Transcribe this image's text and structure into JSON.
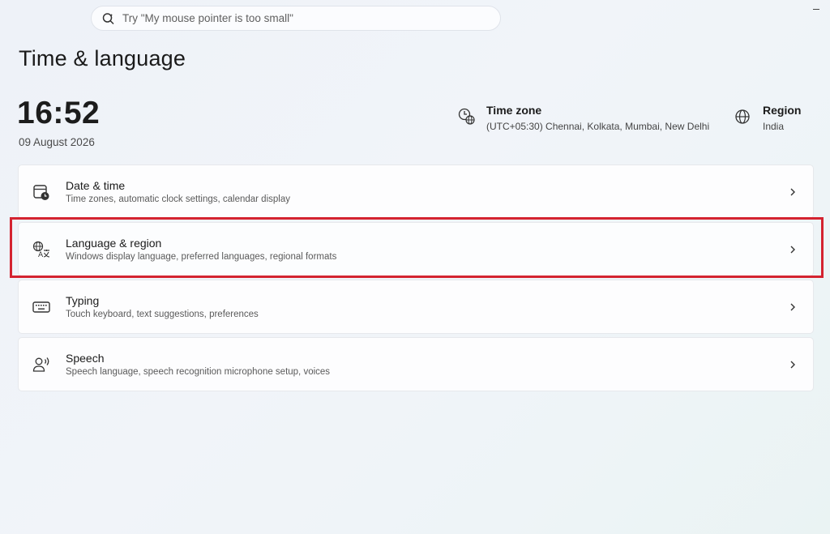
{
  "search": {
    "placeholder": "Try \"My mouse pointer is too small\""
  },
  "page": {
    "title": "Time & language"
  },
  "clock": {
    "time": "16:52",
    "date": "09 August 2026"
  },
  "timezone": {
    "label": "Time zone",
    "value": "(UTC+05:30) Chennai, Kolkata, Mumbai, New Delhi"
  },
  "region": {
    "label": "Region",
    "value": "India"
  },
  "items": [
    {
      "title": "Date & time",
      "subtitle": "Time zones, automatic clock settings, calendar display",
      "icon": "calendar-clock-icon"
    },
    {
      "title": "Language & region",
      "subtitle": "Windows display language, preferred languages, regional formats",
      "icon": "language-icon"
    },
    {
      "title": "Typing",
      "subtitle": "Touch keyboard, text suggestions, preferences",
      "icon": "keyboard-icon"
    },
    {
      "title": "Speech",
      "subtitle": "Speech language, speech recognition microphone setup, voices",
      "icon": "speech-icon"
    }
  ],
  "colors": {
    "highlight": "#d42330"
  }
}
